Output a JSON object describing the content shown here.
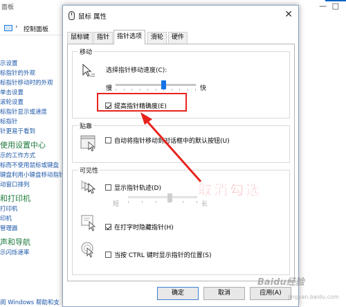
{
  "background_window": {
    "title": "面板",
    "window_buttons": "— □",
    "breadcrumb": "控制面板",
    "links": [
      "示设置",
      "标指针的外观",
      "标指针移动时的外观",
      "单击设置",
      "滚轮设置",
      "标指针显示或速度",
      "标指针",
      "针更易于看到"
    ],
    "section_1_heading": "使用设置中心",
    "section_1_links": [
      "示的工作方式",
      "标而不使用鼠标或键盘",
      "键盘利用小键盘移动指针",
      "动窗口排列"
    ],
    "section_2_heading": "和打印机",
    "section_2_links": [
      "打印机",
      "印机",
      "管理器"
    ],
    "section_3_heading": "声和导航",
    "section_3_links": [
      "示闪烁速率"
    ],
    "footer": "阅 Windows 帮助和支"
  },
  "dialog": {
    "title": "鼠标 属性",
    "close_symbol": "✕",
    "tabs": [
      "鼠标键",
      "指针",
      "指针选项",
      "滑轮",
      "硬件"
    ],
    "active_tab": "指针选项",
    "motion": {
      "group_title": "移动",
      "speed_label": "选择指针移动速度(C):",
      "slow_label": "慢",
      "fast_label": "快",
      "speed_value": 0.6,
      "precision_label": "提高指针精确度(E)",
      "precision_checked": true
    },
    "snap_to": {
      "group_title": "贴靠",
      "label": "自动将指针移动到对话框中的默认按钮(U)",
      "checked": false
    },
    "visibility": {
      "group_title": "可见性",
      "trails_label": "显示指针轨迹(D)",
      "trails_checked": false,
      "short_label": "短",
      "long_label": "长",
      "trails_value": 0.6,
      "hide_label": "在打字时隐藏指针(H)",
      "hide_checked": true,
      "ctrl_label": "当按 CTRL 键时显示指针的位置(S)",
      "ctrl_checked": false
    },
    "buttons": {
      "ok": "确定",
      "cancel": "取消",
      "apply": "应用(A)"
    }
  },
  "annotation": {
    "callout_text": "取消勾选",
    "color": "#e8231e"
  },
  "watermark": {
    "main": "Baidu经验",
    "sub": "jingyan.baidu.com"
  }
}
